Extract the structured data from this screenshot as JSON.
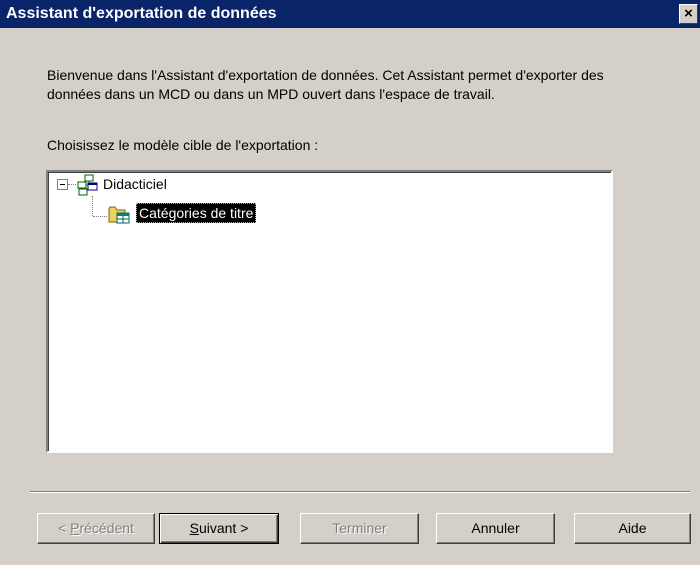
{
  "window": {
    "title": "Assistant d'exportation de données",
    "close_glyph": "×"
  },
  "intro": {
    "text": "Bienvenue dans l'Assistant d'exportation de données. Cet Assistant permet d'exporter des données dans un MCD ou dans un MPD ouvert dans l'espace de travail."
  },
  "prompt": {
    "text": "Choisissez le modèle cible de l'exportation :"
  },
  "tree": {
    "root": {
      "label": "Didacticiel",
      "icon": "model-icon",
      "expanded": true
    },
    "child": {
      "label": "Catégories de titre",
      "icon": "package-icon",
      "selected": true
    }
  },
  "buttons": {
    "prev": {
      "underline": "P",
      "rest": "récédent",
      "prefix": "< "
    },
    "next": {
      "underline": "S",
      "rest": "uivant >"
    },
    "finish": {
      "label": "Terminer"
    },
    "cancel": {
      "label": "Annuler"
    },
    "help": {
      "label": "Aide"
    }
  },
  "colors": {
    "titlebar": "#0a246a",
    "dialog_bg": "#d4d0c8",
    "selection": "#000000"
  }
}
